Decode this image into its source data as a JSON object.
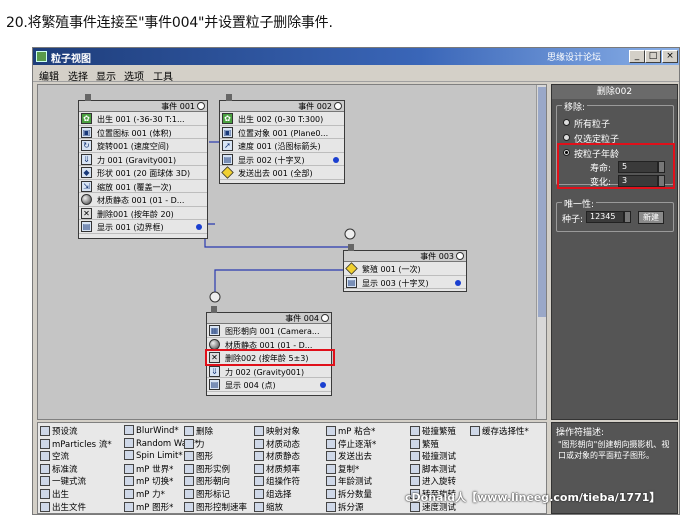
{
  "caption": "20.将繁殖事件连接至\"事件004\"并设置粒子删除事件.",
  "window": {
    "title": "粒子视图",
    "title_right": "思缘设计论坛",
    "buttons": [
      "_",
      "□",
      "×"
    ]
  },
  "menu": [
    "编辑",
    "选择",
    "显示",
    "选项",
    "工具"
  ],
  "events": [
    {
      "title": "事件 001",
      "ops": [
        {
          "icon": "birth-icon",
          "text": "出生 001 (-36-30 T:1..."
        },
        {
          "icon": "position-icon",
          "text": "位置图标 001 (体积)"
        },
        {
          "icon": "spin-icon",
          "text": "旋转001 (速度空间)"
        },
        {
          "icon": "force-icon",
          "text": "力 001 (Gravity001)"
        },
        {
          "icon": "shape-icon",
          "text": "形状 001 (20 面球体 3D)"
        },
        {
          "icon": "scale-icon",
          "text": "缩放 001 (覆盖一次)"
        },
        {
          "icon": "material-icon",
          "text": "材质静态 001 (01 - D..."
        },
        {
          "icon": "delete-icon",
          "text": "删除001 (按年龄 20)"
        },
        {
          "icon": "display-icon",
          "text": "显示 001 (边界框)"
        }
      ]
    },
    {
      "title": "事件 002",
      "ops": [
        {
          "icon": "birth-icon",
          "text": "出生 002 (0-30 T:300)"
        },
        {
          "icon": "position-icon",
          "text": "位置对象 001 (Plane0..."
        },
        {
          "icon": "speed-icon",
          "text": "速度 001 (沿图标箭头)"
        },
        {
          "icon": "display-icon",
          "text": "显示 002 (十字叉)"
        },
        {
          "icon": "spawn-icon",
          "text": "发送出去 001 (全部)"
        }
      ]
    },
    {
      "title": "事件 003",
      "ops": [
        {
          "icon": "spawn-icon",
          "text": "繁殖 001 (一次)"
        },
        {
          "icon": "display-icon",
          "text": "显示 003 (十字叉)"
        }
      ]
    },
    {
      "title": "事件 004",
      "ops": [
        {
          "icon": "shape-facing-icon",
          "text": "图形朝向 001 (Camera..."
        },
        {
          "icon": "material-icon",
          "text": "材质静态 001 (01 - D..."
        },
        {
          "icon": "delete-icon",
          "text": "删除002 (按年龄 5±3)"
        },
        {
          "icon": "force-icon",
          "text": "力 002 (Gravity001)"
        },
        {
          "icon": "display-icon",
          "text": "显示 004 (点)"
        }
      ]
    }
  ],
  "panel": {
    "title": "删除002",
    "remove_group": "移除:",
    "options": [
      "所有粒子",
      "仅选定粒子",
      "按粒子年龄"
    ],
    "selected": "按粒子年龄",
    "life_label": "寿命:",
    "life_value": "5",
    "variation_label": "变化:",
    "variation_value": "3",
    "unique_group": "唯一性:",
    "seed_label": "种子:",
    "seed_value": "12345",
    "new_button": "新建"
  },
  "depot": [
    [
      "预设流",
      "mParticles 流*",
      "空流",
      "标准流",
      "一键式流",
      "出生",
      "出生文件"
    ],
    [
      "BlurWind*",
      "Random Walk*",
      "Spin Limit*",
      "mP 世界*",
      "mP 切换*",
      "mP 力*",
      "mP 图形*"
    ],
    [
      "删除",
      "力",
      "图形",
      "图形实例",
      "图形朝向",
      "图形标记",
      "图形控制速率"
    ],
    [
      "映射对象",
      "材质动态",
      "材质静态",
      "材质频率",
      "组操作符",
      "组选择",
      "缩放"
    ],
    [
      "mP 粘合*",
      "停止逐渐*",
      "发送出去",
      "复制*",
      "年龄测试",
      "拆分数量",
      "拆分源"
    ],
    [
      "碰撞繁殖",
      "繁殖",
      "碰撞测试",
      "脚本测试",
      "进入旋转",
      "转至旋转",
      "速度测试"
    ],
    [
      "缓存选择性*"
    ]
  ],
  "description": {
    "title": "操作符描述:",
    "body": "\"图形朝向\"创建朝向摄影机、视口或对象的平面粒子图形。"
  },
  "watermark": "cDonald人【www.lineeg.com/tieba/1771】"
}
